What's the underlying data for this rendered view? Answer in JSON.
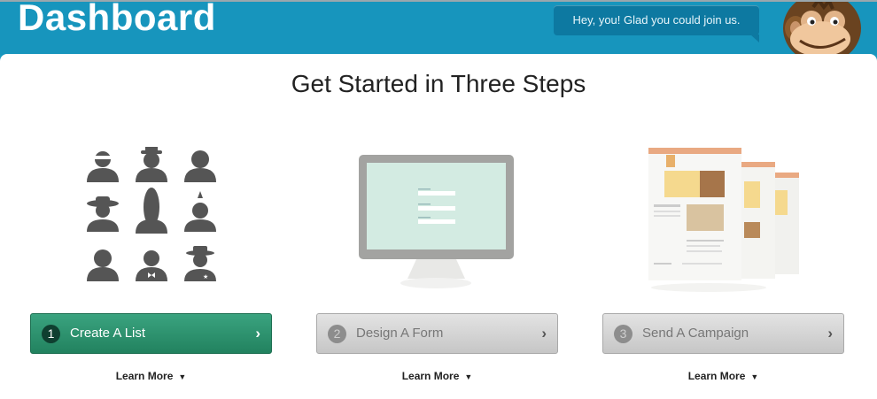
{
  "header": {
    "title": "Dashboard",
    "greeting": "Hey, you! Glad you could join us."
  },
  "main": {
    "heading": "Get Started in Three Steps",
    "steps": [
      {
        "number": "1",
        "label": "Create A List",
        "chevron": "›",
        "learn_more": "Learn More",
        "caret": "▼",
        "state": "active"
      },
      {
        "number": "2",
        "label": "Design A Form",
        "chevron": "›",
        "learn_more": "Learn More",
        "caret": "▼",
        "state": "inactive"
      },
      {
        "number": "3",
        "label": "Send A Campaign",
        "chevron": "›",
        "learn_more": "Learn More",
        "caret": "▼",
        "state": "inactive"
      }
    ]
  },
  "icons": {
    "mascot": "chimp-mascot-icon",
    "step1": "people-silhouettes-icon",
    "step2": "monitor-form-icon",
    "step3": "email-campaign-icon"
  },
  "colors": {
    "header_bg": "#1795bd",
    "bubble_bg": "#0d79a1",
    "active_btn": "#2a8f6c",
    "inactive_btn": "#d3d3d3"
  }
}
